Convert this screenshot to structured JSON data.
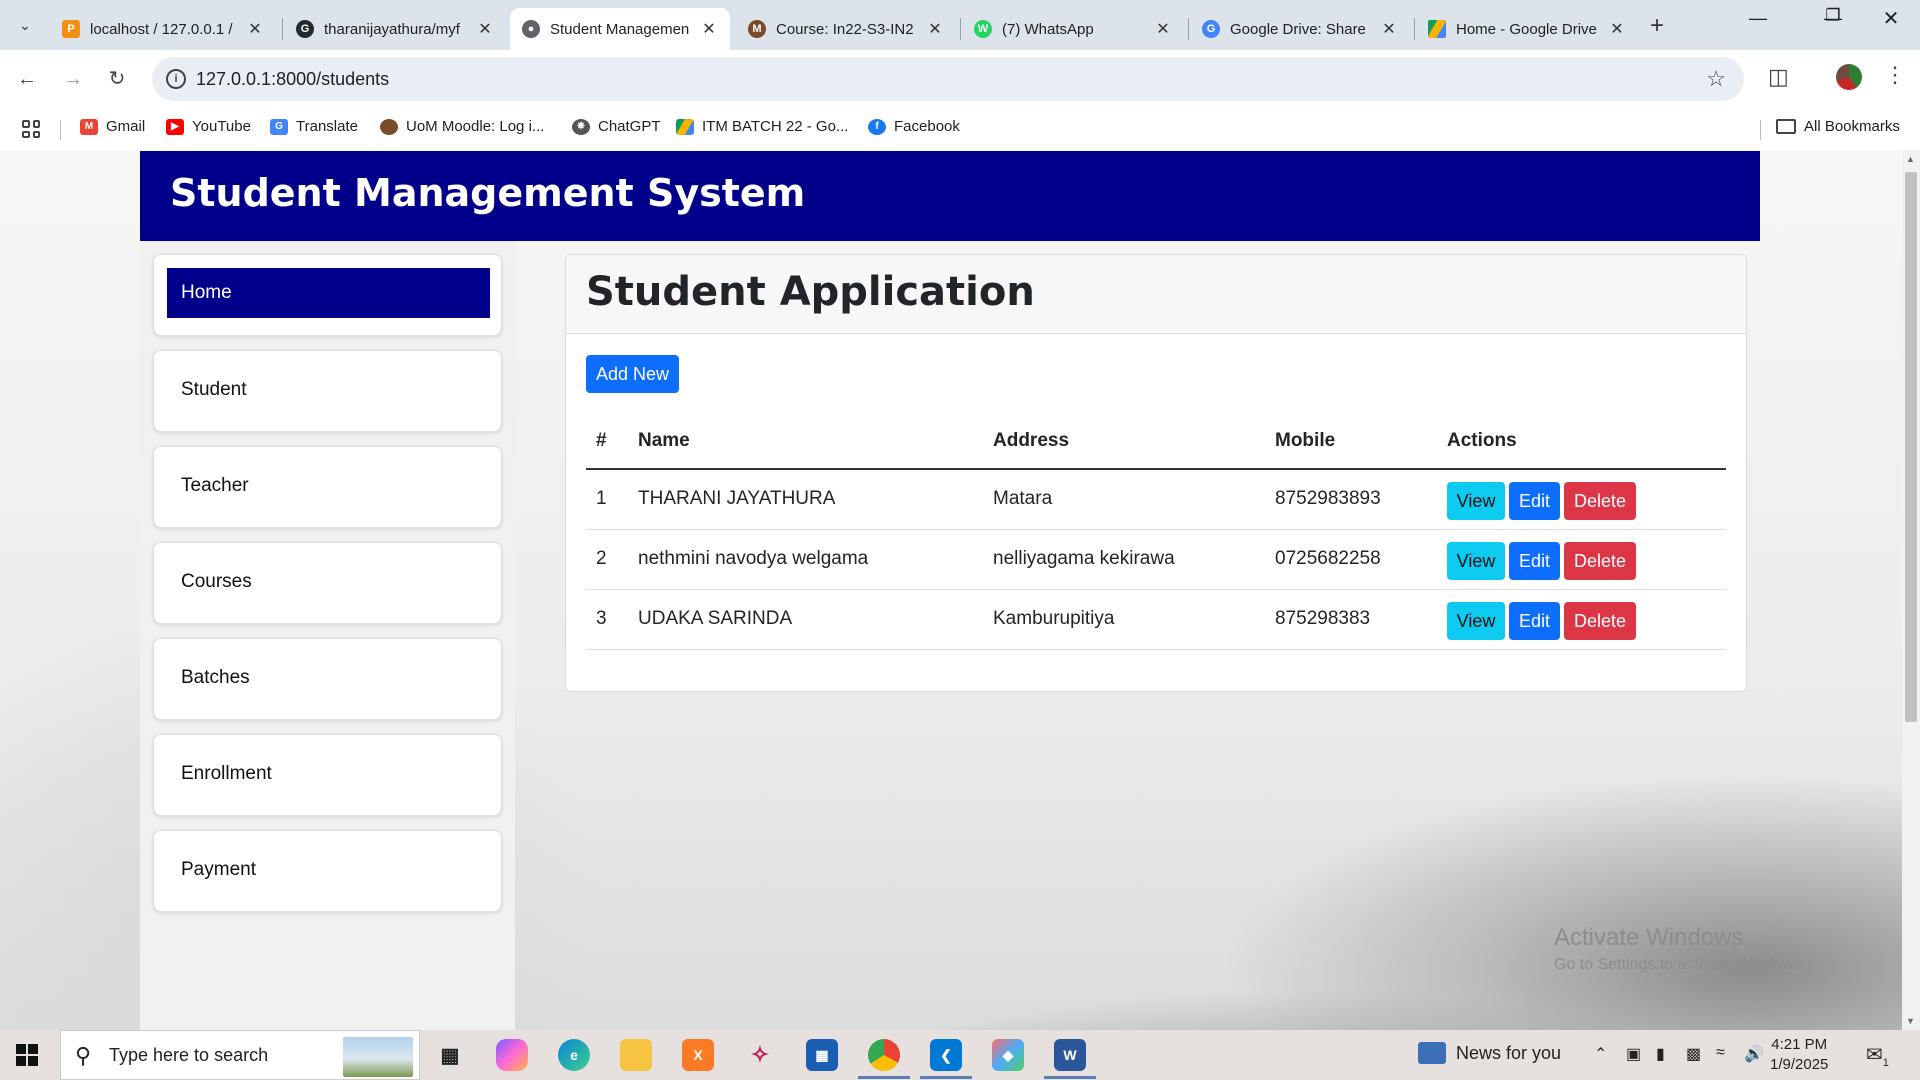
{
  "browser": {
    "tabs": [
      {
        "title": "localhost / 127.0.0.1 /",
        "favicon": "phpmyadmin-icon",
        "active": false
      },
      {
        "title": "tharanijayathura/myf",
        "favicon": "github-icon",
        "active": false
      },
      {
        "title": "Student Managemen",
        "favicon": "globe-icon",
        "active": true
      },
      {
        "title": "Course: In22-S3-IN2",
        "favicon": "moodle-icon",
        "active": false
      },
      {
        "title": "(7) WhatsApp",
        "favicon": "whatsapp-icon",
        "active": false
      },
      {
        "title": "Google Drive: Share",
        "favicon": "google-icon",
        "active": false
      },
      {
        "title": "Home - Google Drive",
        "favicon": "drive-icon",
        "active": false
      }
    ],
    "url": "127.0.0.1:8000/students",
    "bookmarks": [
      {
        "label": "Gmail",
        "icon": "gmail-icon"
      },
      {
        "label": "YouTube",
        "icon": "youtube-icon"
      },
      {
        "label": "Translate",
        "icon": "translate-icon"
      },
      {
        "label": "UoM Moodle: Log i...",
        "icon": "moodle-icon"
      },
      {
        "label": "ChatGPT",
        "icon": "chatgpt-icon"
      },
      {
        "label": "ITM BATCH 22 - Go...",
        "icon": "drive-icon"
      },
      {
        "label": "Facebook",
        "icon": "facebook-icon"
      }
    ],
    "all_bookmarks": "All Bookmarks"
  },
  "app": {
    "title": "Student Management System",
    "nav": [
      {
        "label": "Home",
        "active": true
      },
      {
        "label": "Student",
        "active": false
      },
      {
        "label": "Teacher",
        "active": false
      },
      {
        "label": "Courses",
        "active": false
      },
      {
        "label": "Batches",
        "active": false
      },
      {
        "label": "Enrollment",
        "active": false
      },
      {
        "label": "Payment",
        "active": false
      }
    ],
    "page_title": "Student Application",
    "add_button": "Add New",
    "table": {
      "headers": [
        "#",
        "Name",
        "Address",
        "Mobile",
        "Actions"
      ],
      "rows": [
        {
          "num": "1",
          "name": "THARANI JAYATHURA",
          "address": "Matara",
          "mobile": "8752983893"
        },
        {
          "num": "2",
          "name": "nethmini navodya welgama",
          "address": "nelliyagama kekirawa",
          "mobile": "0725682258"
        },
        {
          "num": "3",
          "name": "UDAKA SARINDA",
          "address": "Kamburupitiya",
          "mobile": "875298383"
        }
      ],
      "actions": {
        "view": "View",
        "edit": "Edit",
        "delete": "Delete"
      }
    }
  },
  "watermark": {
    "line1": "Activate Windows",
    "line2": "Go to Settings to activate Windows."
  },
  "taskbar": {
    "search_placeholder": "Type here to search",
    "news": "News for you",
    "time": "4:21 PM",
    "date": "1/9/2025",
    "notification_count": "1"
  },
  "colors": {
    "header_bg": "#00008b",
    "primary": "#0d6efd",
    "info": "#0dcaf0",
    "danger": "#dc3545"
  }
}
